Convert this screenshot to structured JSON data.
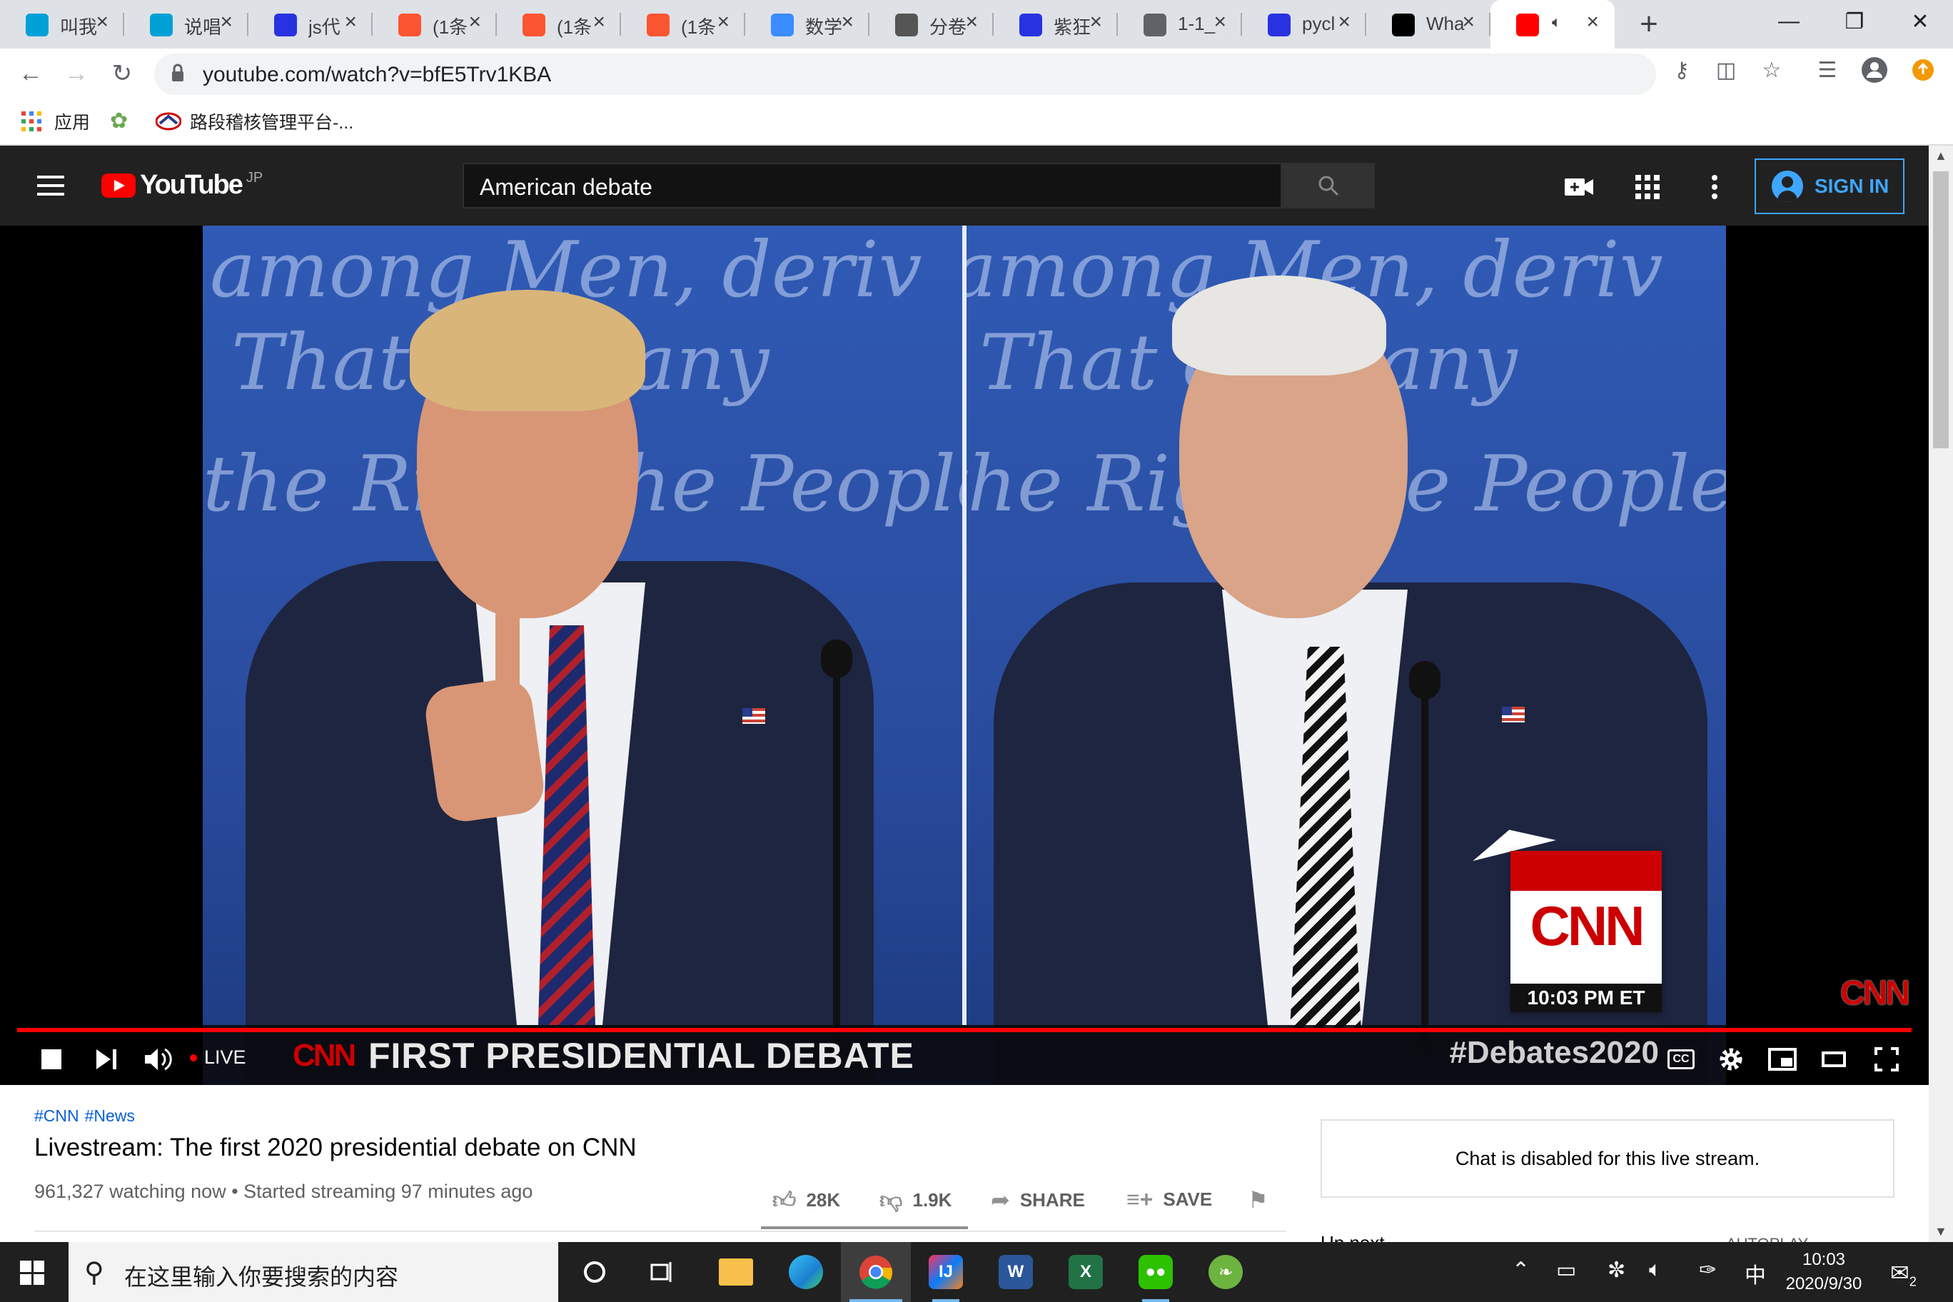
{
  "browser": {
    "tabs": [
      {
        "title": "叫我",
        "favicon": "bilibili-icon",
        "color": "#00a1d6"
      },
      {
        "title": "说唱",
        "favicon": "bilibili-icon",
        "color": "#00a1d6"
      },
      {
        "title": "js代",
        "favicon": "baidu-paw-icon",
        "color": "#2932e1"
      },
      {
        "title": "(1条",
        "favicon": "csdn-icon",
        "color": "#fc5531"
      },
      {
        "title": "(1条",
        "favicon": "csdn-icon",
        "color": "#fc5531"
      },
      {
        "title": "(1条",
        "favicon": "csdn-icon",
        "color": "#fc5531"
      },
      {
        "title": "数学",
        "favicon": "netdisk-icon",
        "color": "#3b8cff"
      },
      {
        "title": "分卷",
        "favicon": "kaggle-icon",
        "color": "#555555"
      },
      {
        "title": "紫狂",
        "favicon": "baidu-paw-icon",
        "color": "#2932e1"
      },
      {
        "title": "1-1_",
        "favicon": "globe-icon",
        "color": "#5f6368"
      },
      {
        "title": "pycl",
        "favicon": "baidu-paw-icon",
        "color": "#2932e1"
      },
      {
        "title": "Wha",
        "favicon": "jetbrains-icon",
        "color": "#000000"
      },
      {
        "title": "",
        "favicon": "youtube-icon",
        "color": "#ff0000",
        "active": true
      }
    ],
    "url": "youtube.com/watch?v=bfE5Trv1KBA",
    "bookmarks": [
      {
        "label": "应用",
        "icon": "apps-grid-icon"
      },
      {
        "label": "",
        "icon": "leaf-icon"
      },
      {
        "label": "路段稽核管理平台-...",
        "icon": "car-logo-icon"
      }
    ]
  },
  "youtube": {
    "logo_text": "YouTube",
    "country_code": "JP",
    "search_value": "American debate",
    "sign_in_label": "SIGN IN"
  },
  "player": {
    "live_label": "LIVE",
    "overlay": {
      "script_text_top": "among Men, deriv",
      "script_text_mid": "That ever any",
      "script_text_low": "the Right the People",
      "cnn_logo": "CNN",
      "time_label": "10:03 PM ET",
      "lower_third_title": "FIRST PRESIDENTIAL DEBATE",
      "lower_third_tag": "#Debates2020"
    },
    "cc_label": "CC"
  },
  "video": {
    "hashtags": [
      "#CNN",
      "#News"
    ],
    "title": "Livestream: The first 2020 presidential debate on CNN",
    "meta": "961,327 watching now • Started streaming 97 minutes ago",
    "likes": "28K",
    "dislikes": "1.9K",
    "share_label": "SHARE",
    "save_label": "SAVE"
  },
  "sidebar": {
    "chat_disabled": "Chat is disabled for this live stream.",
    "up_next": "Up next",
    "autoplay": "AUTOPLAY"
  },
  "taskbar": {
    "search_placeholder": "在这里输入你要搜索的内容",
    "ime_label": "中",
    "time": "10:03",
    "date": "2020/9/30",
    "notification_count": "2"
  }
}
